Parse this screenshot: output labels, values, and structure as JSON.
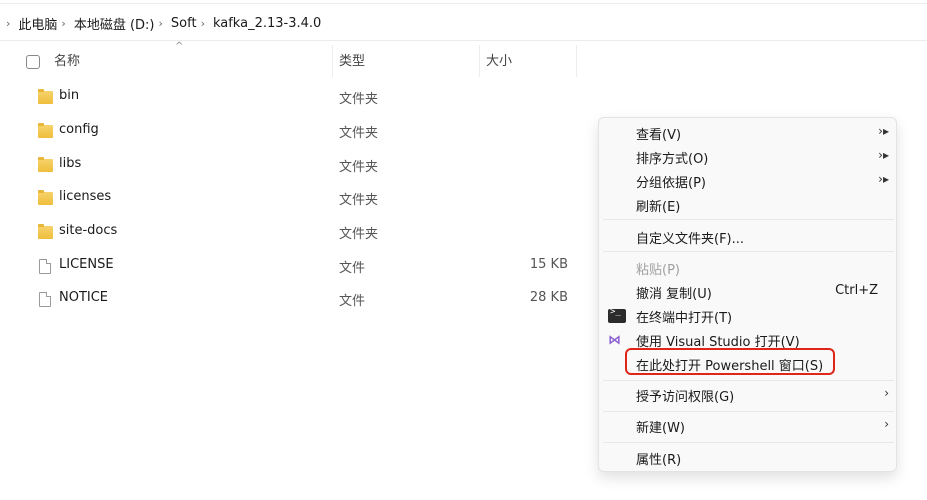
{
  "breadcrumb": {
    "items": [
      "此电脑",
      "本地磁盘 (D:)",
      "Soft",
      "kafka_2.13-3.4.0"
    ]
  },
  "columns": {
    "name": "名称",
    "type": "类型",
    "size": "大小"
  },
  "files": [
    {
      "name": "bin",
      "type": "文件夹",
      "size": "",
      "icon": "folder-icon"
    },
    {
      "name": "config",
      "type": "文件夹",
      "size": "",
      "icon": "folder-icon"
    },
    {
      "name": "libs",
      "type": "文件夹",
      "size": "",
      "icon": "folder-icon"
    },
    {
      "name": "licenses",
      "type": "文件夹",
      "size": "",
      "icon": "folder-icon"
    },
    {
      "name": "site-docs",
      "type": "文件夹",
      "size": "",
      "icon": "folder-icon"
    },
    {
      "name": "LICENSE",
      "type": "文件",
      "size": "15 KB",
      "icon": "file-icon"
    },
    {
      "name": "NOTICE",
      "type": "文件",
      "size": "28 KB",
      "icon": "file-icon"
    }
  ],
  "context_menu": {
    "view": "查看(V)",
    "sort": "排序方式(O)",
    "group": "分组依据(P)",
    "refresh": "刷新(E)",
    "customize": "自定义文件夹(F)...",
    "paste": "粘贴(P)",
    "undo": "撤消 复制(U)",
    "undo_shortcut": "Ctrl+Z",
    "open_terminal": "在终端中打开(T)",
    "open_vs": "使用 Visual Studio 打开(V)",
    "open_powershell": "在此处打开 Powershell 窗口(S)",
    "grant_access": "授予访问权限(G)",
    "new": "新建(W)",
    "properties": "属性(R)",
    "submenu_arrow": "›",
    "submenu_arrow_filled": "›▸"
  },
  "icons": {
    "breadcrumb_sep": "›",
    "sort_caret": "^",
    "vs": "⋈"
  },
  "colors": {
    "highlight_border": "#e0251a"
  }
}
